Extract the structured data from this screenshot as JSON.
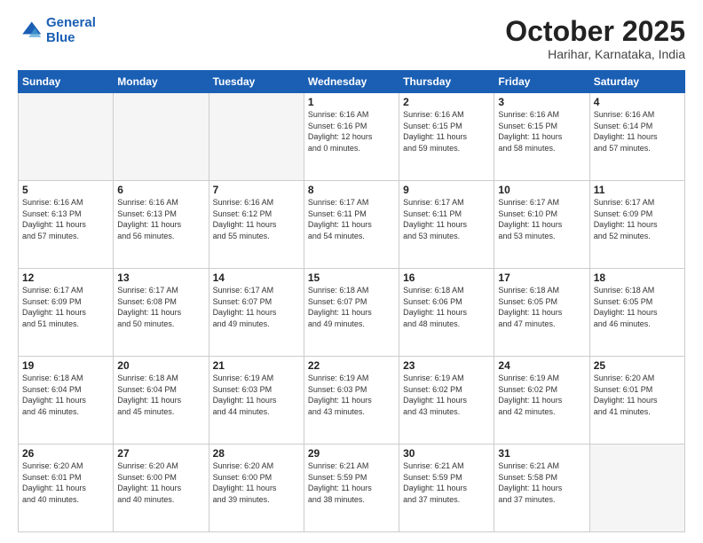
{
  "logo": {
    "line1": "General",
    "line2": "Blue"
  },
  "header": {
    "title": "October 2025",
    "location": "Harihar, Karnataka, India"
  },
  "weekdays": [
    "Sunday",
    "Monday",
    "Tuesday",
    "Wednesday",
    "Thursday",
    "Friday",
    "Saturday"
  ],
  "weeks": [
    [
      {
        "day": "",
        "info": ""
      },
      {
        "day": "",
        "info": ""
      },
      {
        "day": "",
        "info": ""
      },
      {
        "day": "1",
        "info": "Sunrise: 6:16 AM\nSunset: 6:16 PM\nDaylight: 12 hours\nand 0 minutes."
      },
      {
        "day": "2",
        "info": "Sunrise: 6:16 AM\nSunset: 6:15 PM\nDaylight: 11 hours\nand 59 minutes."
      },
      {
        "day": "3",
        "info": "Sunrise: 6:16 AM\nSunset: 6:15 PM\nDaylight: 11 hours\nand 58 minutes."
      },
      {
        "day": "4",
        "info": "Sunrise: 6:16 AM\nSunset: 6:14 PM\nDaylight: 11 hours\nand 57 minutes."
      }
    ],
    [
      {
        "day": "5",
        "info": "Sunrise: 6:16 AM\nSunset: 6:13 PM\nDaylight: 11 hours\nand 57 minutes."
      },
      {
        "day": "6",
        "info": "Sunrise: 6:16 AM\nSunset: 6:13 PM\nDaylight: 11 hours\nand 56 minutes."
      },
      {
        "day": "7",
        "info": "Sunrise: 6:16 AM\nSunset: 6:12 PM\nDaylight: 11 hours\nand 55 minutes."
      },
      {
        "day": "8",
        "info": "Sunrise: 6:17 AM\nSunset: 6:11 PM\nDaylight: 11 hours\nand 54 minutes."
      },
      {
        "day": "9",
        "info": "Sunrise: 6:17 AM\nSunset: 6:11 PM\nDaylight: 11 hours\nand 53 minutes."
      },
      {
        "day": "10",
        "info": "Sunrise: 6:17 AM\nSunset: 6:10 PM\nDaylight: 11 hours\nand 53 minutes."
      },
      {
        "day": "11",
        "info": "Sunrise: 6:17 AM\nSunset: 6:09 PM\nDaylight: 11 hours\nand 52 minutes."
      }
    ],
    [
      {
        "day": "12",
        "info": "Sunrise: 6:17 AM\nSunset: 6:09 PM\nDaylight: 11 hours\nand 51 minutes."
      },
      {
        "day": "13",
        "info": "Sunrise: 6:17 AM\nSunset: 6:08 PM\nDaylight: 11 hours\nand 50 minutes."
      },
      {
        "day": "14",
        "info": "Sunrise: 6:17 AM\nSunset: 6:07 PM\nDaylight: 11 hours\nand 49 minutes."
      },
      {
        "day": "15",
        "info": "Sunrise: 6:18 AM\nSunset: 6:07 PM\nDaylight: 11 hours\nand 49 minutes."
      },
      {
        "day": "16",
        "info": "Sunrise: 6:18 AM\nSunset: 6:06 PM\nDaylight: 11 hours\nand 48 minutes."
      },
      {
        "day": "17",
        "info": "Sunrise: 6:18 AM\nSunset: 6:05 PM\nDaylight: 11 hours\nand 47 minutes."
      },
      {
        "day": "18",
        "info": "Sunrise: 6:18 AM\nSunset: 6:05 PM\nDaylight: 11 hours\nand 46 minutes."
      }
    ],
    [
      {
        "day": "19",
        "info": "Sunrise: 6:18 AM\nSunset: 6:04 PM\nDaylight: 11 hours\nand 46 minutes."
      },
      {
        "day": "20",
        "info": "Sunrise: 6:18 AM\nSunset: 6:04 PM\nDaylight: 11 hours\nand 45 minutes."
      },
      {
        "day": "21",
        "info": "Sunrise: 6:19 AM\nSunset: 6:03 PM\nDaylight: 11 hours\nand 44 minutes."
      },
      {
        "day": "22",
        "info": "Sunrise: 6:19 AM\nSunset: 6:03 PM\nDaylight: 11 hours\nand 43 minutes."
      },
      {
        "day": "23",
        "info": "Sunrise: 6:19 AM\nSunset: 6:02 PM\nDaylight: 11 hours\nand 43 minutes."
      },
      {
        "day": "24",
        "info": "Sunrise: 6:19 AM\nSunset: 6:02 PM\nDaylight: 11 hours\nand 42 minutes."
      },
      {
        "day": "25",
        "info": "Sunrise: 6:20 AM\nSunset: 6:01 PM\nDaylight: 11 hours\nand 41 minutes."
      }
    ],
    [
      {
        "day": "26",
        "info": "Sunrise: 6:20 AM\nSunset: 6:01 PM\nDaylight: 11 hours\nand 40 minutes."
      },
      {
        "day": "27",
        "info": "Sunrise: 6:20 AM\nSunset: 6:00 PM\nDaylight: 11 hours\nand 40 minutes."
      },
      {
        "day": "28",
        "info": "Sunrise: 6:20 AM\nSunset: 6:00 PM\nDaylight: 11 hours\nand 39 minutes."
      },
      {
        "day": "29",
        "info": "Sunrise: 6:21 AM\nSunset: 5:59 PM\nDaylight: 11 hours\nand 38 minutes."
      },
      {
        "day": "30",
        "info": "Sunrise: 6:21 AM\nSunset: 5:59 PM\nDaylight: 11 hours\nand 37 minutes."
      },
      {
        "day": "31",
        "info": "Sunrise: 6:21 AM\nSunset: 5:58 PM\nDaylight: 11 hours\nand 37 minutes."
      },
      {
        "day": "",
        "info": ""
      }
    ]
  ]
}
